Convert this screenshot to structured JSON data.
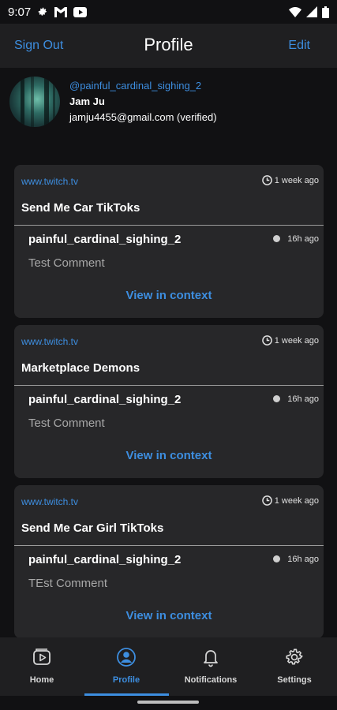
{
  "status_bar": {
    "time": "9:07",
    "icons": [
      "settings-icon",
      "gmail-icon",
      "youtube-icon",
      "wifi-icon",
      "signal-icon",
      "battery-icon"
    ]
  },
  "header": {
    "sign_out": "Sign Out",
    "title": "Profile",
    "edit": "Edit"
  },
  "profile": {
    "username": "@painful_cardinal_sighing_2",
    "name": "Jam Ju",
    "email": "jamju4455@gmail.com (verified)"
  },
  "cards": [
    {
      "site": "www.twitch.tv",
      "time": "1 week ago",
      "title": "Send Me Car TikToks",
      "comment_user": "painful_cardinal_sighing_2",
      "comment_time": "16h ago",
      "comment_text": "Test Comment",
      "context_link": "View in context"
    },
    {
      "site": "www.twitch.tv",
      "time": "1 week ago",
      "title": "Marketplace Demons",
      "comment_user": "painful_cardinal_sighing_2",
      "comment_time": "16h ago",
      "comment_text": "Test Comment",
      "context_link": "View in context"
    },
    {
      "site": "www.twitch.tv",
      "time": "1 week ago",
      "title": "Send Me Car Girl TikToks",
      "comment_user": "painful_cardinal_sighing_2",
      "comment_time": "16h ago",
      "comment_text": "TEst Comment",
      "context_link": "View in context"
    }
  ],
  "nav": {
    "items": [
      {
        "label": "Home",
        "icon": "home-video-icon"
      },
      {
        "label": "Profile",
        "icon": "profile-icon"
      },
      {
        "label": "Notifications",
        "icon": "bell-icon"
      },
      {
        "label": "Settings",
        "icon": "gear-icon"
      }
    ],
    "active": "Profile"
  },
  "colors": {
    "accent": "#3d8ee0",
    "background": "#111113",
    "card": "#272729",
    "bar": "#1f1f21"
  }
}
